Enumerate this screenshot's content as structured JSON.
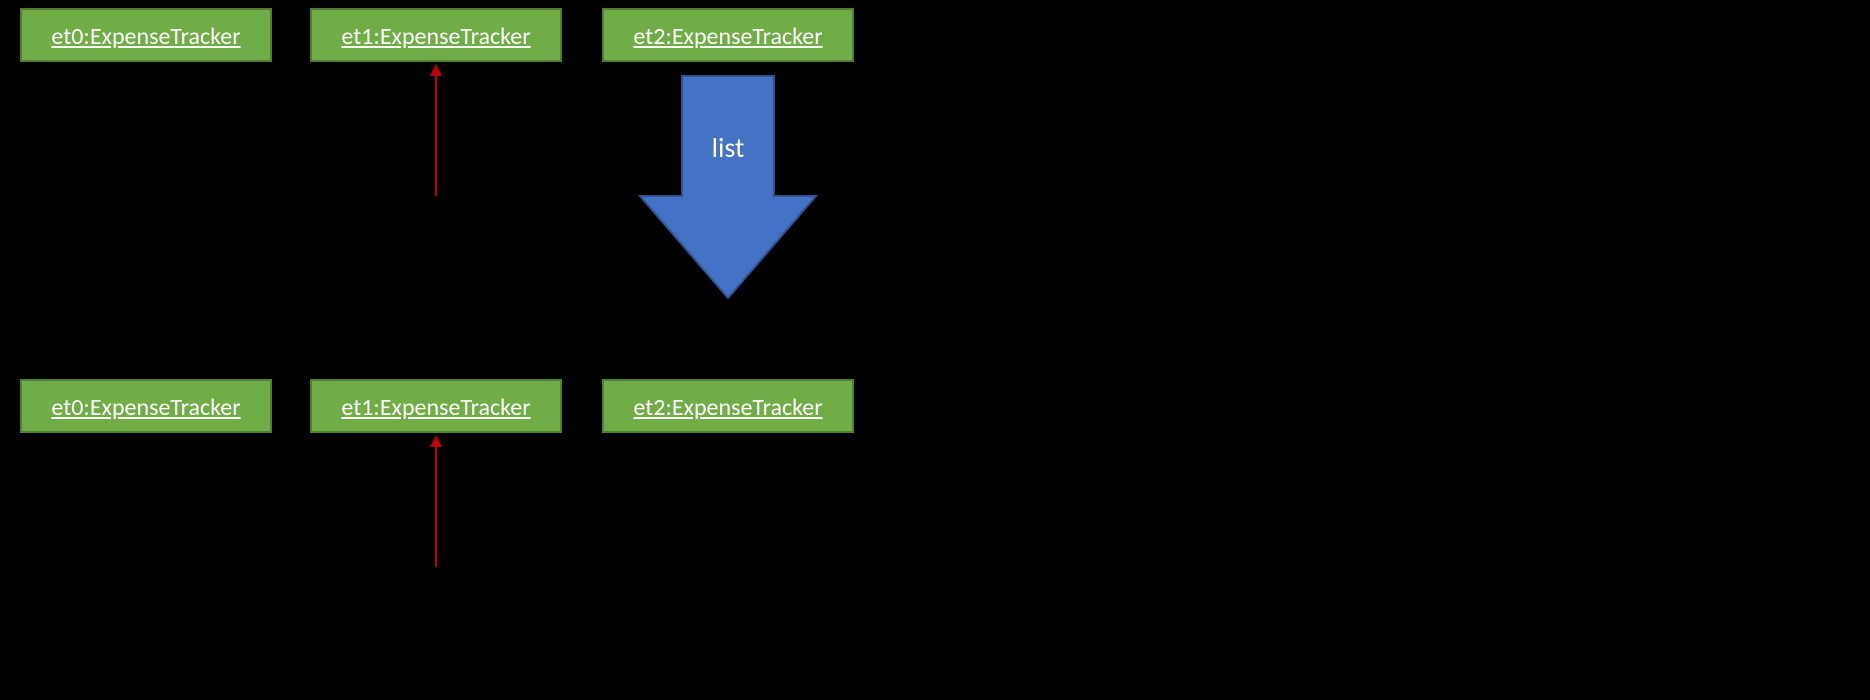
{
  "row1": {
    "et0": "et0:ExpenseTracker",
    "et1": "et1:ExpenseTracker",
    "et2": "et2:ExpenseTracker"
  },
  "row2": {
    "et0": "et0:ExpenseTracker",
    "et1": "et1:ExpenseTracker",
    "et2": "et2:ExpenseTracker"
  },
  "arrows": {
    "big_label": "list"
  },
  "colors": {
    "box_fill": "#70ad47",
    "box_border": "#507e32",
    "red_arrow": "#c00000",
    "big_arrow": "#4472c4",
    "big_arrow_border": "#2f528f"
  }
}
